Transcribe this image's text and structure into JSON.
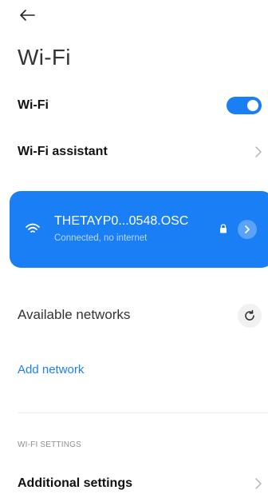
{
  "header": {
    "back_icon": "arrow-left-icon",
    "title": "Wi-Fi"
  },
  "wifi_toggle": {
    "label": "Wi-Fi",
    "enabled": true
  },
  "wifi_assistant": {
    "label": "Wi-Fi assistant",
    "icon": "chevron-right-icon"
  },
  "connected_network": {
    "name": "THETAYP0...0548.OSC",
    "status": "Connected, no internet",
    "signal_icon": "wifi-icon",
    "secure_icon": "lock-icon",
    "details_icon": "chevron-right-icon"
  },
  "available_networks": {
    "label": "Available networks",
    "refresh_icon": "refresh-icon"
  },
  "add_network": {
    "label": "Add network"
  },
  "settings_section": {
    "caption": "WI-FI SETTINGS",
    "items": [
      {
        "label": "Additional settings",
        "icon": "chevron-right-icon"
      }
    ]
  },
  "colors": {
    "accent": "#1a7ff5",
    "card_status": "#bcd9ff",
    "caption": "#8e8e8e"
  }
}
